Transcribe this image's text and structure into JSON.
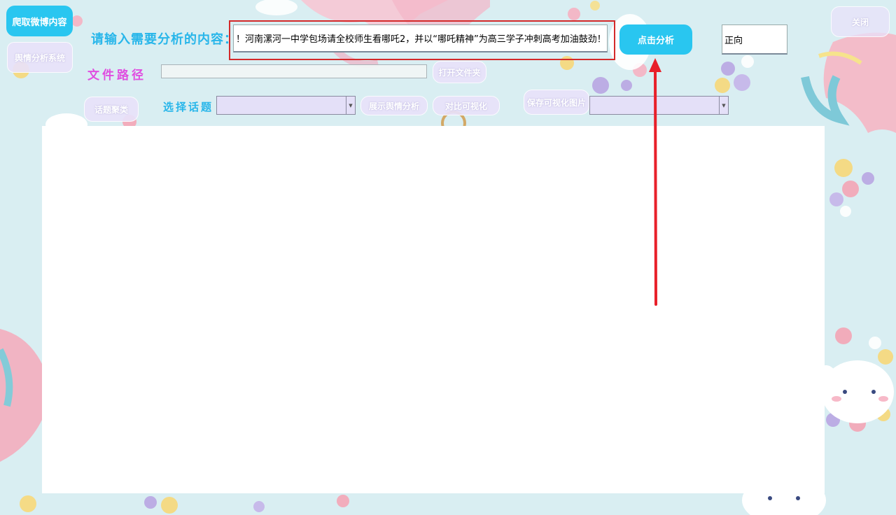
{
  "theme": {
    "accent": "#29c6f0",
    "highlight": "#d42a2a",
    "arrow": "#e8202a",
    "label_pink": "#e04ee0",
    "label_cyan": "#28b6ea"
  },
  "sidebar": {
    "crawl_button": "爬取微博内容",
    "system_button": "舆情分析系统"
  },
  "header": {
    "input_label": "请输入需要分析的内容：",
    "input_value": "！河南漯河一中学包场请全校师生看哪吒2，并以“哪吒精神”为高三学子冲刺高考加油鼓劲！",
    "analyze_button": "点击分析",
    "result_value": "正向",
    "close_button": "关闭"
  },
  "file_row": {
    "label": "文件路径",
    "path_value": "",
    "open_folder_button": "打开文件夹"
  },
  "topic_row": {
    "cluster_button": "话题聚类",
    "select_label": "选择话题",
    "topic_selected": "",
    "show_button": "展示舆情分析",
    "compare_button": "对比可视化",
    "save_button": "保存可视化图片",
    "image_selected": ""
  }
}
